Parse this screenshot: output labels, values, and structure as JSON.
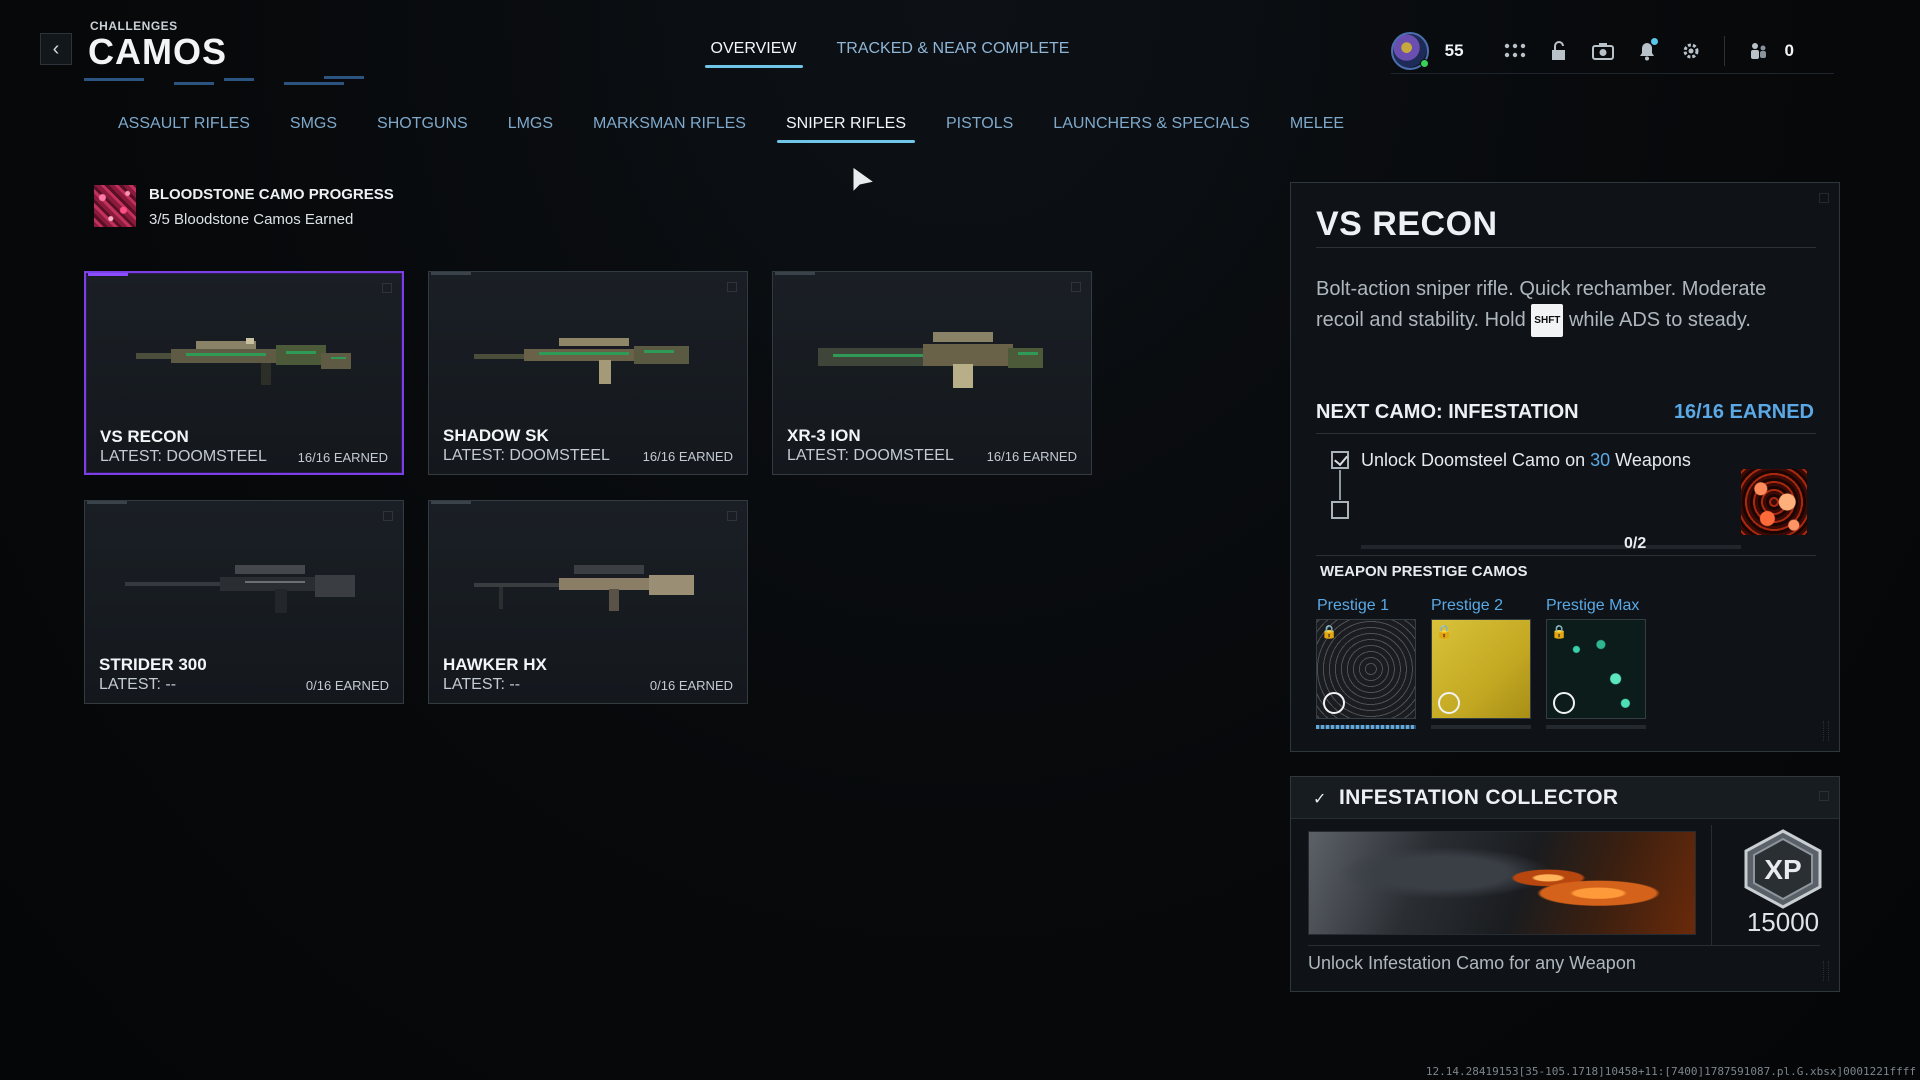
{
  "header": {
    "breadcrumb": "CHALLENGES",
    "title": "CAMOS",
    "back_icon": "chevron-left-icon"
  },
  "top_tabs": [
    {
      "label": "OVERVIEW",
      "active": true
    },
    {
      "label": "TRACKED & NEAR COMPLETE",
      "active": false
    }
  ],
  "hud": {
    "rank": "55",
    "count": "0",
    "icons": [
      "grid-icon",
      "lock-icon",
      "camera-icon",
      "bell-icon",
      "gear-icon",
      "party-icon"
    ]
  },
  "categories": [
    {
      "label": "ASSAULT RIFLES",
      "active": false
    },
    {
      "label": "SMGS",
      "active": false
    },
    {
      "label": "SHOTGUNS",
      "active": false
    },
    {
      "label": "LMGS",
      "active": false
    },
    {
      "label": "MARKSMAN RIFLES",
      "active": false
    },
    {
      "label": "SNIPER RIFLES",
      "active": true
    },
    {
      "label": "PISTOLS",
      "active": false
    },
    {
      "label": "LAUNCHERS & SPECIALS",
      "active": false
    },
    {
      "label": "MELEE",
      "active": false
    }
  ],
  "bloodstone": {
    "title": "BLOODSTONE CAMO PROGRESS",
    "subtitle": "3/5 Bloodstone Camos Earned"
  },
  "weapons": [
    {
      "name": "VS RECON",
      "latest": "LATEST: DOOMSTEEL",
      "earned": "16/16 EARNED",
      "selected": true
    },
    {
      "name": "SHADOW SK",
      "latest": "LATEST: DOOMSTEEL",
      "earned": "16/16 EARNED",
      "selected": false
    },
    {
      "name": "XR-3 ION",
      "latest": "LATEST: DOOMSTEEL",
      "earned": "16/16 EARNED",
      "selected": false
    },
    {
      "name": "STRIDER 300",
      "latest": "LATEST: --",
      "earned": "0/16 EARNED",
      "selected": false
    },
    {
      "name": "HAWKER HX",
      "latest": "LATEST: --",
      "earned": "0/16 EARNED",
      "selected": false
    }
  ],
  "detail": {
    "title": "VS RECON",
    "desc_before": "Bolt-action sniper rifle.  Quick rechamber. Moderate recoil and stability.  Hold",
    "key": "SHFT",
    "desc_after": "while ADS to steady.",
    "next_camo": "NEXT CAMO: INFESTATION",
    "next_earned": "16/16 EARNED",
    "task_prefix": "Unlock Doomsteel Camo on",
    "task_count": "30",
    "task_suffix": "Weapons",
    "task_progress": "0/2",
    "task_progress_fraction": 0,
    "prestige_header": "WEAPON PRESTIGE CAMOS",
    "prestige": [
      {
        "label": "Prestige 1",
        "progress_fraction": 1
      },
      {
        "label": "Prestige 2",
        "progress_fraction": 0
      },
      {
        "label": "Prestige Max",
        "progress_fraction": 0
      }
    ]
  },
  "collector": {
    "title": "INFESTATION COLLECTOR",
    "xp_label": "XP",
    "xp_value": "15000",
    "description": "Unlock Infestation Camo for any Weapon"
  },
  "build": "12.14.28419153[35-105.1718]10458+11:[7400]1787591087.pl.G.xbsx]0001221ffff"
}
